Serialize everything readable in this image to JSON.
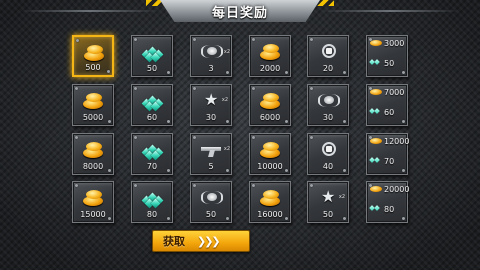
{
  "title": "每日奖励",
  "claim_button": {
    "label": "获取",
    "arrows": "❯❯❯"
  },
  "colors": {
    "accent": "#f5b514",
    "gem": "#38d6b8",
    "gold": "#f2a10b"
  },
  "rewards": [
    [
      {
        "icon": "gold-coins-icon",
        "qty": "500",
        "active": true
      },
      {
        "icon": "gems-icon",
        "qty": "50"
      },
      {
        "icon": "spider-robot-icon",
        "qty": "3",
        "badge": "x2"
      },
      {
        "icon": "gold-coins-icon",
        "qty": "2000"
      },
      {
        "icon": "mech-drone-icon",
        "qty": "20"
      },
      {
        "icon": "gold-and-gems-icon",
        "gold": "3000",
        "gems": "50"
      }
    ],
    [
      {
        "icon": "gold-coins-icon",
        "qty": "5000"
      },
      {
        "icon": "gems-icon",
        "qty": "60"
      },
      {
        "icon": "star-emblem-icon",
        "qty": "30",
        "badge": "x2"
      },
      {
        "icon": "gold-coins-icon",
        "qty": "6000"
      },
      {
        "icon": "spider-robot-icon",
        "qty": "30"
      },
      {
        "icon": "gold-and-gems-icon",
        "gold": "7000",
        "gems": "60"
      }
    ],
    [
      {
        "icon": "gold-coins-icon",
        "qty": "8000"
      },
      {
        "icon": "gems-icon",
        "qty": "70"
      },
      {
        "icon": "gun-icon",
        "qty": "5",
        "badge": "x2"
      },
      {
        "icon": "gold-coins-icon",
        "qty": "10000"
      },
      {
        "icon": "mech-drone-icon",
        "qty": "40"
      },
      {
        "icon": "gold-and-gems-icon",
        "gold": "12000",
        "gems": "70"
      }
    ],
    [
      {
        "icon": "gold-coins-icon",
        "qty": "15000"
      },
      {
        "icon": "gems-icon",
        "qty": "80"
      },
      {
        "icon": "spider-robot-icon",
        "qty": "50"
      },
      {
        "icon": "gold-coins-icon",
        "qty": "16000"
      },
      {
        "icon": "star-emblem-icon",
        "qty": "50",
        "badge": "x2"
      },
      {
        "icon": "gold-and-gems-icon",
        "gold": "20000",
        "gems": "80"
      }
    ]
  ]
}
